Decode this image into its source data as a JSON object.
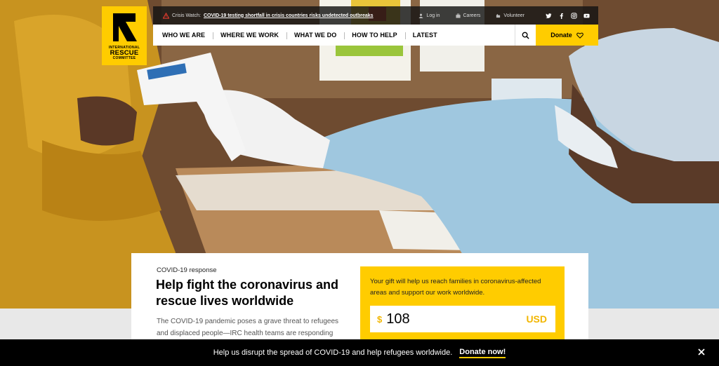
{
  "logo": {
    "line1": "INTERNATIONAL",
    "line2": "RESCUE",
    "line3": "COMMITTEE"
  },
  "topbar": {
    "alert_label": "Crisis Watch:",
    "alert_link": "COVID-19 testing shortfall in crisis countries risks undetected outbreaks",
    "utils": [
      {
        "label": "Log in",
        "icon": "user-icon"
      },
      {
        "label": "Careers",
        "icon": "briefcase-icon"
      },
      {
        "label": "Volunteer",
        "icon": "hand-icon"
      }
    ],
    "social": [
      "twitter-icon",
      "facebook-icon",
      "instagram-icon",
      "youtube-icon"
    ]
  },
  "nav": {
    "items": [
      "WHO WE ARE",
      "WHERE WE WORK",
      "WHAT WE DO",
      "HOW TO HELP",
      "LATEST"
    ],
    "donate_label": "Donate"
  },
  "card": {
    "eyebrow": "COVID-19 response",
    "headline": "Help fight the coronavirus and rescue lives worldwide",
    "lede": "The COVID-19 pandemic poses a grave threat to refugees and displaced people—IRC health teams are responding"
  },
  "donation": {
    "message": "Your gift will help us reach families in coronavirus-affected areas and support our work worldwide.",
    "currency_symbol": "$",
    "amount": "108",
    "currency_code": "USD"
  },
  "banner": {
    "text": "Help us disrupt the spread of COVID-19 and help refugees worldwide.",
    "cta": "Donate now!"
  },
  "colors": {
    "brand_yellow": "#ffcc00",
    "banner_bg": "#000000",
    "nav_bg": "#ffffff"
  }
}
